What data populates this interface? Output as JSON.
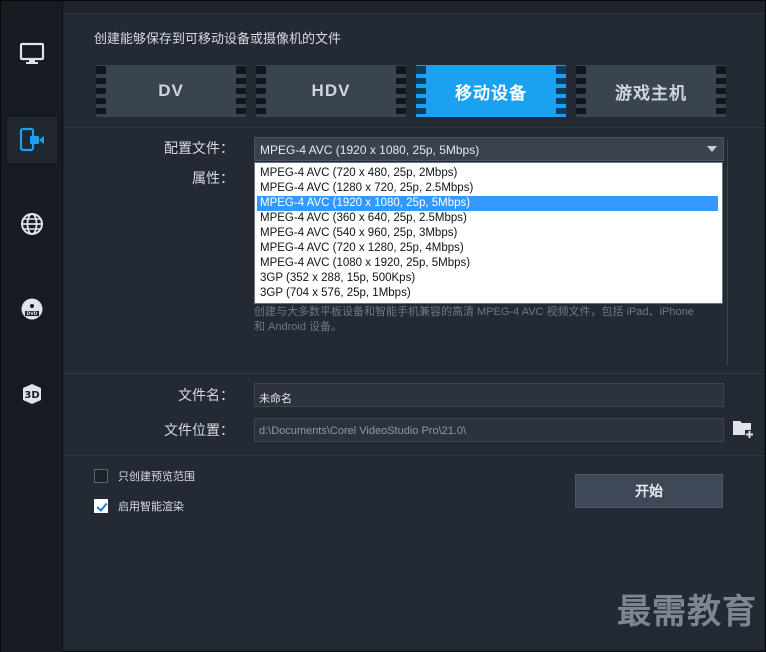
{
  "header": {
    "title": "创建能够保存到可移动设备或摄像机的文件"
  },
  "sidebar": {
    "items": [
      {
        "icon": "monitor-icon"
      },
      {
        "icon": "mobile-device-icon",
        "active": true
      },
      {
        "icon": "globe-icon"
      },
      {
        "icon": "dvd-icon"
      },
      {
        "icon": "3d-icon"
      }
    ]
  },
  "tabs": [
    {
      "label": "DV"
    },
    {
      "label": "HDV"
    },
    {
      "label": "移动设备",
      "active": true
    },
    {
      "label": "游戏主机"
    }
  ],
  "form": {
    "profile_label": "配置文件：",
    "profile_value": "MPEG-4 AVC (1920 x 1080, 25p, 5Mbps)",
    "properties_label": "属性：",
    "options": [
      "MPEG-4 AVC (720 x 480, 25p, 2Mbps)",
      "MPEG-4 AVC (1280 x 720, 25p, 2.5Mbps)",
      "MPEG-4 AVC (1920 x 1080, 25p, 5Mbps)",
      "MPEG-4 AVC (360 x 640, 25p, 2.5Mbps)",
      "MPEG-4 AVC (540 x 960, 25p, 3Mbps)",
      "MPEG-4 AVC (720 x 1280, 25p, 4Mbps)",
      "MPEG-4 AVC (1080 x 1920, 25p, 5Mbps)",
      "3GP (352 x 288, 15p, 500Kps)",
      "3GP (704 x 576, 25p, 1Mbps)"
    ],
    "selected_index": 2,
    "description": "创建与大多数平板设备和智能手机兼容的高清 MPEG-4 AVC 视频文件，包括 iPad、iPhone 和 Android 设备。",
    "filename_label": "文件名：",
    "filename_value": "未命名",
    "location_label": "文件位置：",
    "location_value": "d:\\Documents\\Corel VideoStudio Pro\\21.0\\"
  },
  "options": {
    "preview_range_label": "只创建预览范围",
    "preview_range_checked": false,
    "smart_render_label": "启用智能渲染",
    "smart_render_checked": true
  },
  "start_button": {
    "label": "开始"
  },
  "watermark": "最需教育",
  "colors": {
    "accent": "#1aa2f0",
    "selection": "#3399ff"
  }
}
